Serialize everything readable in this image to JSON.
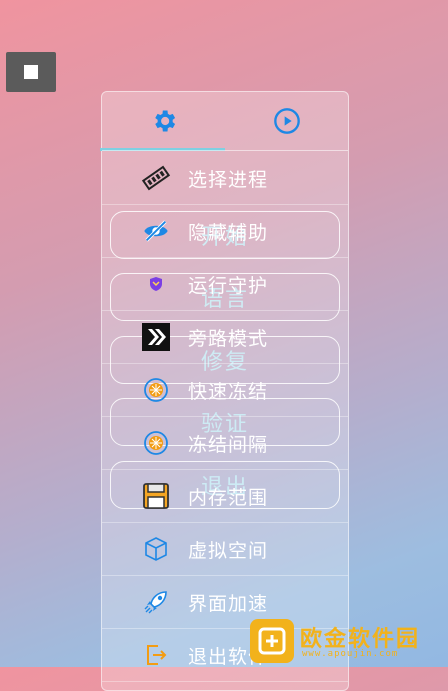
{
  "background_buttons": [
    {
      "label": "开始"
    },
    {
      "label": "语言"
    },
    {
      "label": "修复"
    },
    {
      "label": "验证"
    },
    {
      "label": "退出"
    }
  ],
  "panel": {
    "tabs": [
      {
        "icon": "gear-icon",
        "selected": true
      },
      {
        "icon": "play-circle-icon",
        "selected": false
      }
    ],
    "items": [
      {
        "label": "选择进程",
        "icon": "memory-chip-icon"
      },
      {
        "label": "隐藏辅助",
        "icon": "eye-off-icon"
      },
      {
        "label": "运行守护",
        "icon": "shield-icon"
      },
      {
        "label": "旁路模式",
        "icon": "bypass-icon"
      },
      {
        "label": "快速冻结",
        "icon": "snowflake-icon"
      },
      {
        "label": "冻结间隔",
        "icon": "snowflake-icon"
      },
      {
        "label": "内存范围",
        "icon": "floppy-disk-icon"
      },
      {
        "label": "虚拟空间",
        "icon": "cube-icon"
      },
      {
        "label": "界面加速",
        "icon": "rocket-icon"
      },
      {
        "label": "退出软件",
        "icon": "exit-icon"
      }
    ]
  },
  "watermark": {
    "name": "欧金软件园",
    "url": "www.apoujin.com"
  },
  "colors": {
    "accent_blue": "#1e88e5",
    "tab_underline": "#7fd0e2",
    "snow_orange": "#f39c12",
    "watermark_gold": "#f2b21b"
  }
}
